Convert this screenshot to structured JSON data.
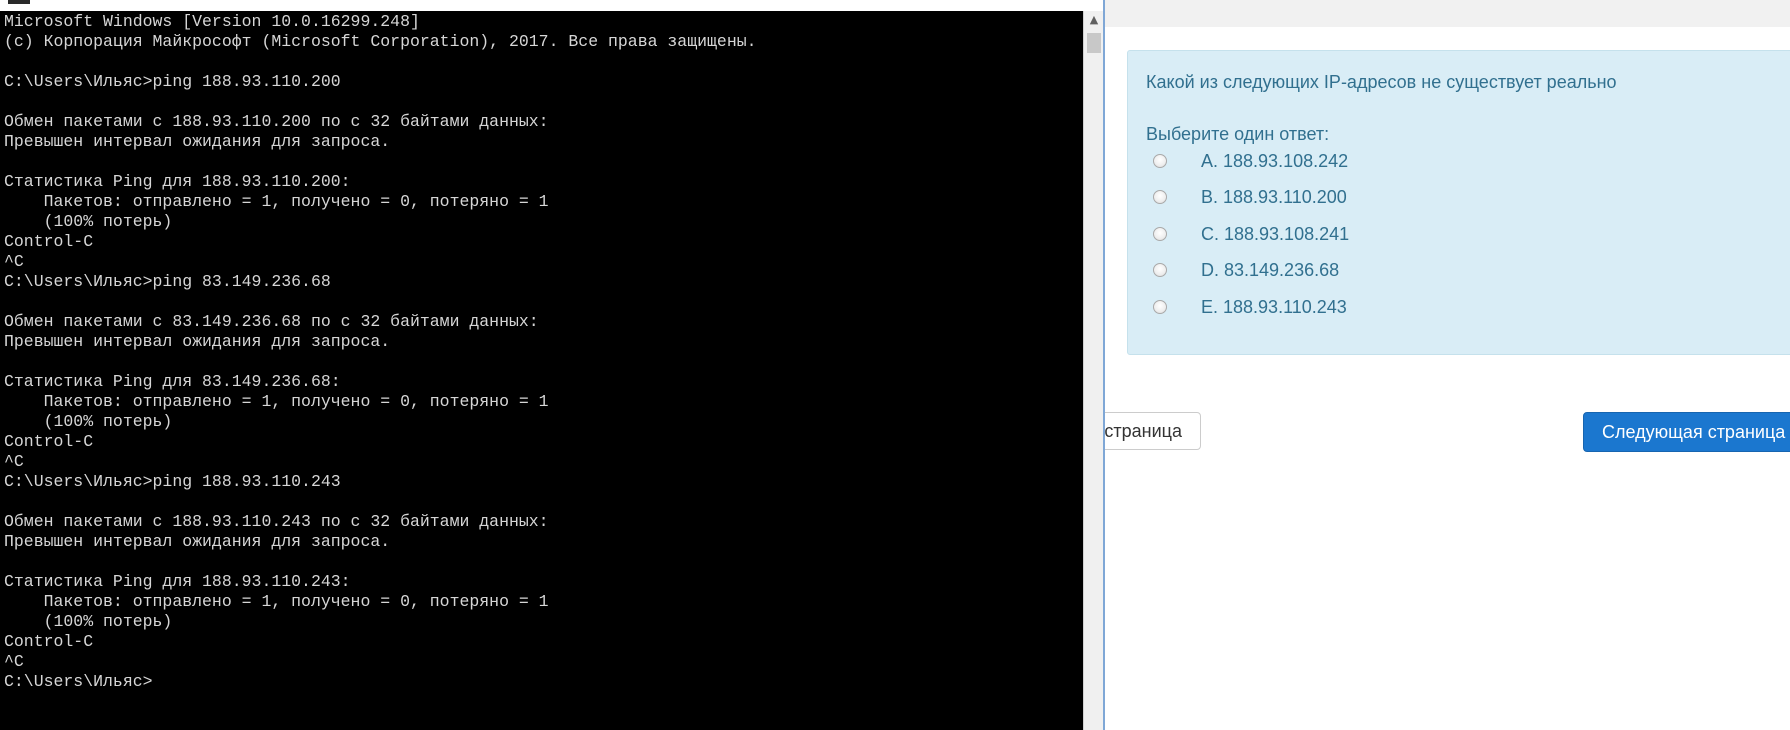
{
  "console": {
    "lines": [
      "Microsoft Windows [Version 10.0.16299.248]",
      "(c) Корпорация Майкрософт (Microsoft Corporation), 2017. Все права защищены.",
      "",
      "C:\\Users\\Ильяс>ping 188.93.110.200",
      "",
      "Обмен пакетами с 188.93.110.200 по с 32 байтами данных:",
      "Превышен интервал ожидания для запроса.",
      "",
      "Статистика Ping для 188.93.110.200:",
      "    Пакетов: отправлено = 1, получено = 0, потеряно = 1",
      "    (100% потерь)",
      "Control-C",
      "^C",
      "C:\\Users\\Ильяс>ping 83.149.236.68",
      "",
      "Обмен пакетами с 83.149.236.68 по с 32 байтами данных:",
      "Превышен интервал ожидания для запроса.",
      "",
      "Статистика Ping для 83.149.236.68:",
      "    Пакетов: отправлено = 1, получено = 0, потеряно = 1",
      "    (100% потерь)",
      "Control-C",
      "^C",
      "C:\\Users\\Ильяс>ping 188.93.110.243",
      "",
      "Обмен пакетами с 188.93.110.243 по с 32 байтами данных:",
      "Превышен интервал ожидания для запроса.",
      "",
      "Статистика Ping для 188.93.110.243:",
      "    Пакетов: отправлено = 1, получено = 0, потеряно = 1",
      "    (100% потерь)",
      "Control-C",
      "^C",
      "C:\\Users\\Ильяс>"
    ],
    "scroll_up_icon": "scroll-up-arrow-icon"
  },
  "quiz": {
    "question": "Какой из следующих IP-адресов не существует реально",
    "prompt": "Выберите один ответ:",
    "options": [
      {
        "label": "A. 188.93.108.242",
        "selected": false
      },
      {
        "label": "B. 188.93.110.200",
        "selected": false
      },
      {
        "label": "C. 188.93.108.241",
        "selected": false
      },
      {
        "label": "D. 83.149.236.68",
        "selected": false
      },
      {
        "label": "E. 188.93.110.243",
        "selected": false
      }
    ],
    "prev_button": "страница",
    "next_button": "Следующая страница"
  },
  "colors": {
    "panel_background": "#d9edf6",
    "panel_text": "#31708f",
    "primary_button": "#1b77cf",
    "console_background": "#000000",
    "console_text": "#d6d6d6"
  }
}
